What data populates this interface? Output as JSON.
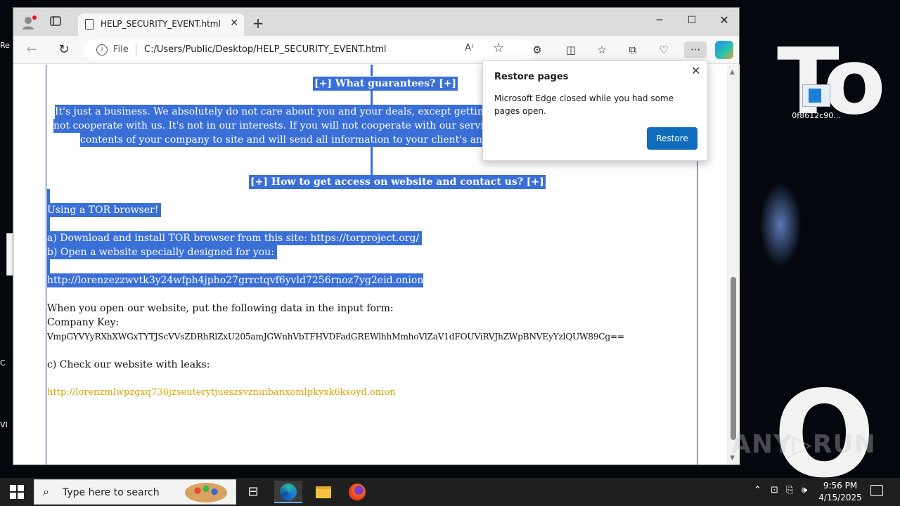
{
  "desktop": {
    "bg_text_1": "To",
    "bg_text_2": "O",
    "icon_label": "0f8612c90...",
    "left_labels": [
      "Re",
      "C",
      "VI"
    ]
  },
  "browser": {
    "tab_title": "HELP_SECURITY_EVENT.html",
    "address": {
      "scheme_label": "File",
      "url": "C:/Users/Public/Desktop/HELP_SECURITY_EVENT.html",
      "read_aloud": "A⁾"
    }
  },
  "page": {
    "heading_guarantees": "[+] What guarantees? [+]",
    "guarantees_lines": [
      "It's just a business. We absolutely do not care about you and your deals, except getting benefits. If we",
      "not cooperate with us. It's not in our interests. If you will not cooperate with our service - for us, it's d",
      "contents of your company to site and will send all information to your client's and mass media. Y"
    ],
    "heading_access": "[+] How to get access on website and contact us? [+]",
    "using_tor": "Using a TOR browser!",
    "step_a": "a) Download and install TOR browser from this site: https://torproject.org/",
    "step_b": "b) Open a website specially designed for you:",
    "onion_link_1": "http://lorenzezzwvtk3y24wfph4jpho27grrctqvf6yvld7256rnoz7yg2eid.onion",
    "instruction": "When you open our website, put the following data in the input form:",
    "company_key_label": "Company Key:",
    "company_key": "VmpGYVYyRXhXWGxTYTJScVVsZDRhRlZxU205amJGWnhVbTFHVDFadGREWlhhMmhoVlZaV1dFOUViRVJhZWpBNVEyYzlQUW89Cg==",
    "step_c": "c) Check our website with leaks:",
    "onion_link_2": "http://lorenzmlwpzgxq736jzseuterytjueszsvznuibanxomlpkyxk6ksoyd.onion"
  },
  "restore_popup": {
    "title": "Restore pages",
    "message": "Microsoft Edge closed while you had some pages open.",
    "button": "Restore",
    "button_color": "#0f6cbd"
  },
  "watermark": "ANY▷RUN",
  "taskbar": {
    "search_placeholder": "Type here to search",
    "time": "9:56 PM",
    "date": "4/15/2025"
  },
  "colors": {
    "selection": "#3a6fd8",
    "link": "#d9a300"
  }
}
